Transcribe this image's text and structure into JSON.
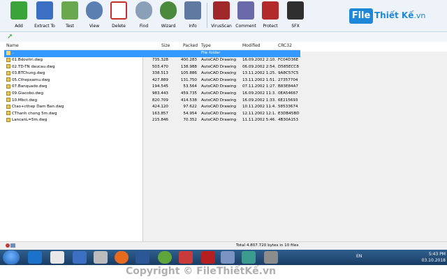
{
  "toolbar": {
    "buttons": [
      {
        "label": "Add",
        "icon": "add-icon",
        "color": "#3aa33a"
      },
      {
        "label": "Extract To",
        "icon": "extract-icon",
        "color": "#3b6fc2"
      },
      {
        "label": "Test",
        "icon": "test-icon",
        "color": "#6aa84f"
      },
      {
        "label": "View",
        "icon": "view-icon",
        "color": "#5a7fb0"
      },
      {
        "label": "Delete",
        "icon": "delete-icon",
        "color": "#c7302a"
      },
      {
        "label": "Find",
        "icon": "find-icon",
        "color": "#8aa0b8"
      },
      {
        "label": "Wizard",
        "icon": "wizard-icon",
        "color": "#4b8a3d"
      },
      {
        "label": "Info",
        "icon": "info-icon",
        "color": "#5f7aa0"
      },
      {
        "label": "VirusScan",
        "icon": "virusscan-icon",
        "color": "#a02828"
      },
      {
        "label": "Comment",
        "icon": "comment-icon",
        "color": "#6a6aa8"
      },
      {
        "label": "Protect",
        "icon": "protect-icon",
        "color": "#b32a2a"
      },
      {
        "label": "SFX",
        "icon": "sfx-icon",
        "color": "#2f2f2f"
      }
    ]
  },
  "logo": {
    "box": "File",
    "text": "Thiết Kế",
    "suffix": ".vn"
  },
  "columns": {
    "name": "Name",
    "size": "Size",
    "packed": "Packed",
    "type": "Type",
    "modified": "Modified",
    "crc": "CRC32"
  },
  "rows": [
    {
      "name": "..",
      "size": "",
      "packed": "",
      "type": "File folder",
      "modified": "",
      "crc": "",
      "selected": true
    },
    {
      "name": "01.Bdovitri.dwg",
      "size": "735.328",
      "packed": "400.283",
      "type": "AutoCAD Drawing",
      "modified": "16.09.2002 2:10...",
      "crc": "FC04D36E"
    },
    {
      "name": "02.TD-TN daucau.dwg",
      "size": "503.470",
      "packed": "138.988",
      "type": "AutoCAD Drawing",
      "modified": "06.09.2002 2:54...",
      "crc": "D585ECC8"
    },
    {
      "name": "03.BTChung.dwg",
      "size": "338.513",
      "packed": "105.886",
      "type": "AutoCAD Drawing",
      "modified": "13.11.2002 1:25...",
      "crc": "9A8C57C5"
    },
    {
      "name": "05.Cthepsamu.dwg",
      "size": "427.889",
      "packed": "131.750",
      "type": "AutoCAD Drawing",
      "modified": "13.11.2002 1:51...",
      "crc": "27357704"
    },
    {
      "name": "07.Banquado.dwg",
      "size": "194.545",
      "packed": "53.564",
      "type": "AutoCAD Drawing",
      "modified": "07.11.2002 1:27...",
      "crc": "B83E84A7"
    },
    {
      "name": "09.Giacobo.dwg",
      "size": "983.443",
      "packed": "459.735",
      "type": "AutoCAD Drawing",
      "modified": "16.09.2002 11:3...",
      "crc": "0EA54667"
    },
    {
      "name": "10.Mbct.dwg",
      "size": "820.709",
      "packed": "414.538",
      "type": "AutoCAD Drawing",
      "modified": "16.09.2002 1:33...",
      "crc": "6E215693"
    },
    {
      "name": "Ctao+cthep Dam Ban.dwg",
      "size": "424.120",
      "packed": "97.622",
      "type": "AutoCAD Drawing",
      "modified": "10.11.2002 11:4...",
      "crc": "58533674"
    },
    {
      "name": "CThanh chong 5m.dwg",
      "size": "163.857",
      "packed": "54.954",
      "type": "AutoCAD Drawing",
      "modified": "12.11.2002 12:1...",
      "crc": "E3DB45BD"
    },
    {
      "name": "LancanL=5m.dwg",
      "size": "215.846",
      "packed": "70.352",
      "type": "AutoCAD Drawing",
      "modified": "11.11.2002 5:46...",
      "crc": "4B30A153"
    }
  ],
  "status": {
    "text": "Total 4.807.720 bytes in 10 files"
  },
  "taskbar": {
    "apps": [
      {
        "icon": "ie-icon",
        "color": "#1a73c9"
      },
      {
        "icon": "unikey-icon",
        "color": "#e8e8e8"
      },
      {
        "icon": "winrar-files-icon",
        "color": "#3b6fc2"
      },
      {
        "icon": "media-icon",
        "color": "#bcbcbc"
      },
      {
        "icon": "firefox-icon",
        "color": "#e66b1e"
      },
      {
        "icon": "word-icon",
        "color": "#2b5797"
      },
      {
        "icon": "green-app-icon",
        "color": "#5fa53a"
      },
      {
        "icon": "red-app-icon",
        "color": "#c93a3a"
      },
      {
        "icon": "autocad-icon",
        "color": "#b51f1f"
      },
      {
        "icon": "winrar-taskbar-icon",
        "color": "#7b93c2"
      },
      {
        "icon": "vn-app-icon",
        "color": "#3b9b8e"
      },
      {
        "icon": "tool-icon",
        "color": "#8c8c8c"
      }
    ],
    "lang": "EN",
    "time": "5:43 PM",
    "date": "03.10.2018"
  },
  "watermark": "Copyright © FileThiếtKế.vn"
}
